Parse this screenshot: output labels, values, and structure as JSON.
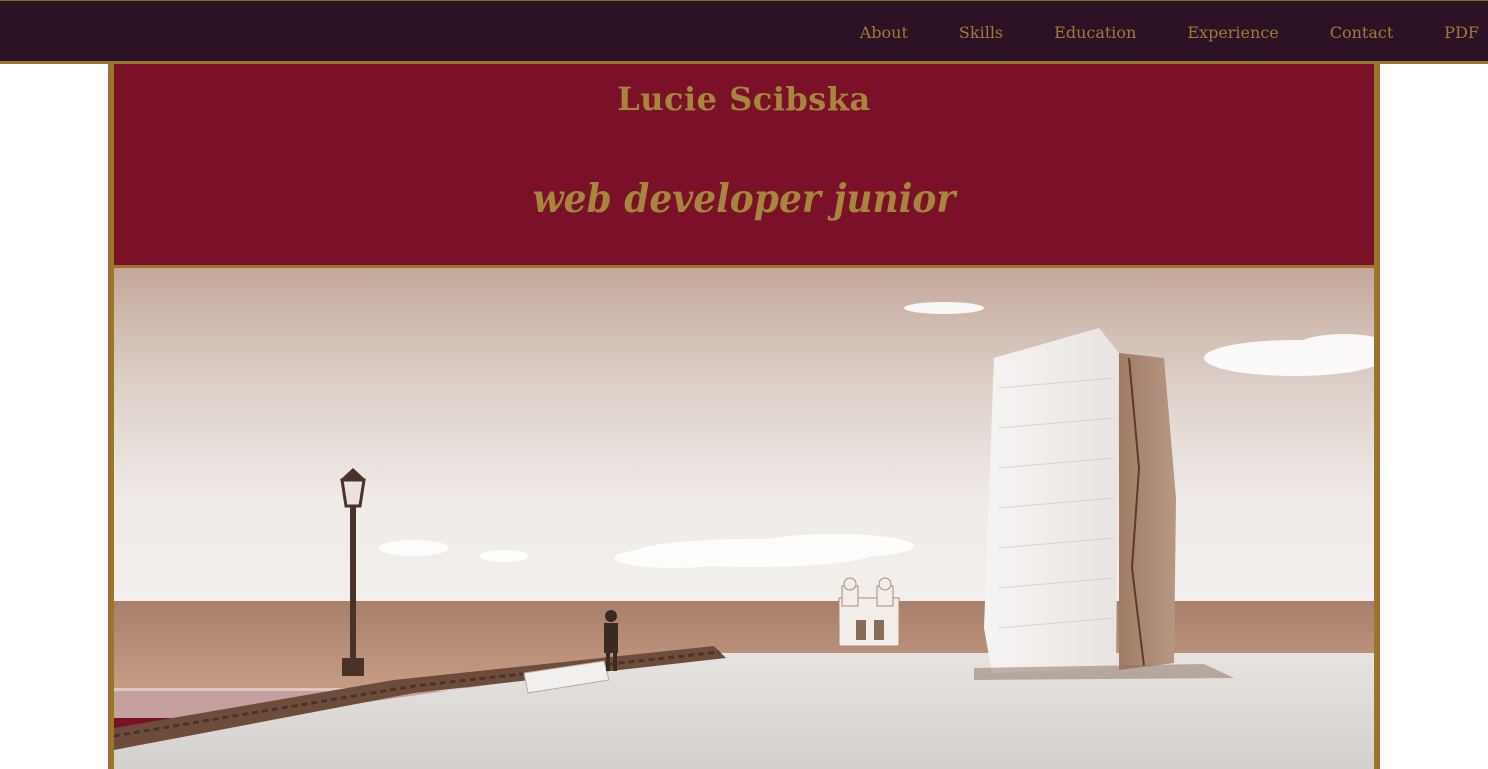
{
  "nav": {
    "items": [
      {
        "label": "About"
      },
      {
        "label": "Skills"
      },
      {
        "label": "Education"
      },
      {
        "label": "Experience"
      },
      {
        "label": "Contact"
      },
      {
        "label": "PDF"
      }
    ]
  },
  "header": {
    "name": "Lucie Scibska",
    "tagline": "web developer junior"
  },
  "colors": {
    "navbar_bg": "#2d1124",
    "accent_gold": "#9a7530",
    "header_bg": "#7b1128",
    "text_gold": "#a8853c"
  },
  "hero": {
    "image": "sepia coastal photo: lamp post, person walking by stone wall, white chapel, tall split monolith, sea and clouds"
  }
}
